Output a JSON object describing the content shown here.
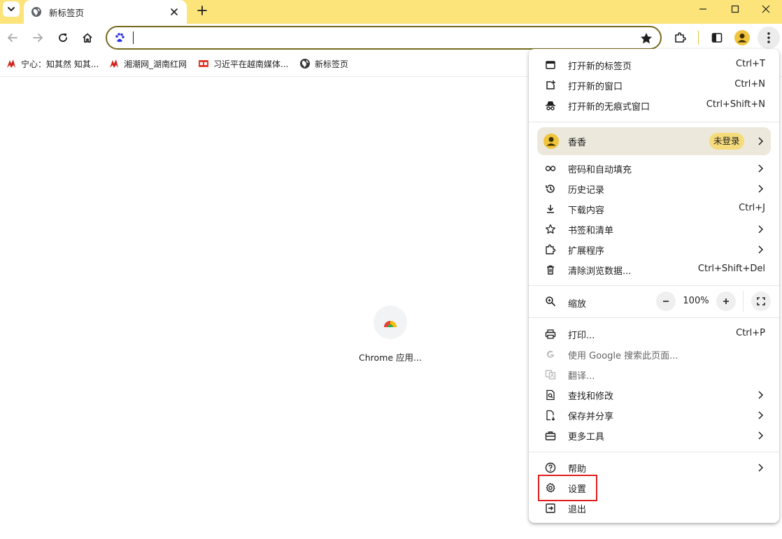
{
  "tab": {
    "title": "新标签页"
  },
  "toolbar": {
    "omnibox_value": ""
  },
  "bookmarks": [
    {
      "label": "宁心：知其然 知其...",
      "icon": "red-logo-icon"
    },
    {
      "label": "湘潮网_湖南红网",
      "icon": "red-logo-icon"
    },
    {
      "label": "习近平在越南媒体...",
      "icon": "news-badge-icon"
    },
    {
      "label": "新标签页",
      "icon": "globe-icon"
    }
  ],
  "content": {
    "apps_label": "Chrome 应用..."
  },
  "menu": {
    "new_tab": {
      "label": "打开新的标签页",
      "shortcut": "Ctrl+T"
    },
    "new_window": {
      "label": "打开新的窗口",
      "shortcut": "Ctrl+N"
    },
    "new_incognito": {
      "label": "打开新的无痕式窗口",
      "shortcut": "Ctrl+Shift+N"
    },
    "profile": {
      "name": "香香",
      "status": "未登录"
    },
    "passwords": {
      "label": "密码和自动填充"
    },
    "history": {
      "label": "历史记录"
    },
    "downloads": {
      "label": "下载内容",
      "shortcut": "Ctrl+J"
    },
    "bookmarks": {
      "label": "书签和清单"
    },
    "extensions": {
      "label": "扩展程序"
    },
    "clear_data": {
      "label": "清除浏览数据...",
      "shortcut": "Ctrl+Shift+Del"
    },
    "zoom": {
      "label": "缩放",
      "value": "100%"
    },
    "print": {
      "label": "打印...",
      "shortcut": "Ctrl+P"
    },
    "search_google": {
      "label": "使用 Google 搜索此页面..."
    },
    "translate": {
      "label": "翻译..."
    },
    "find_edit": {
      "label": "查找和修改"
    },
    "save_share": {
      "label": "保存并分享"
    },
    "more_tools": {
      "label": "更多工具"
    },
    "help": {
      "label": "帮助"
    },
    "settings": {
      "label": "设置"
    },
    "exit": {
      "label": "退出"
    }
  },
  "colors": {
    "tabstrip_bg": "#fce47a",
    "omnibox_border": "#746a1d",
    "profile_bg": "#ece8dc",
    "profile_badge_bg": "#f6db7b",
    "highlight_border": "#e01e1e"
  }
}
